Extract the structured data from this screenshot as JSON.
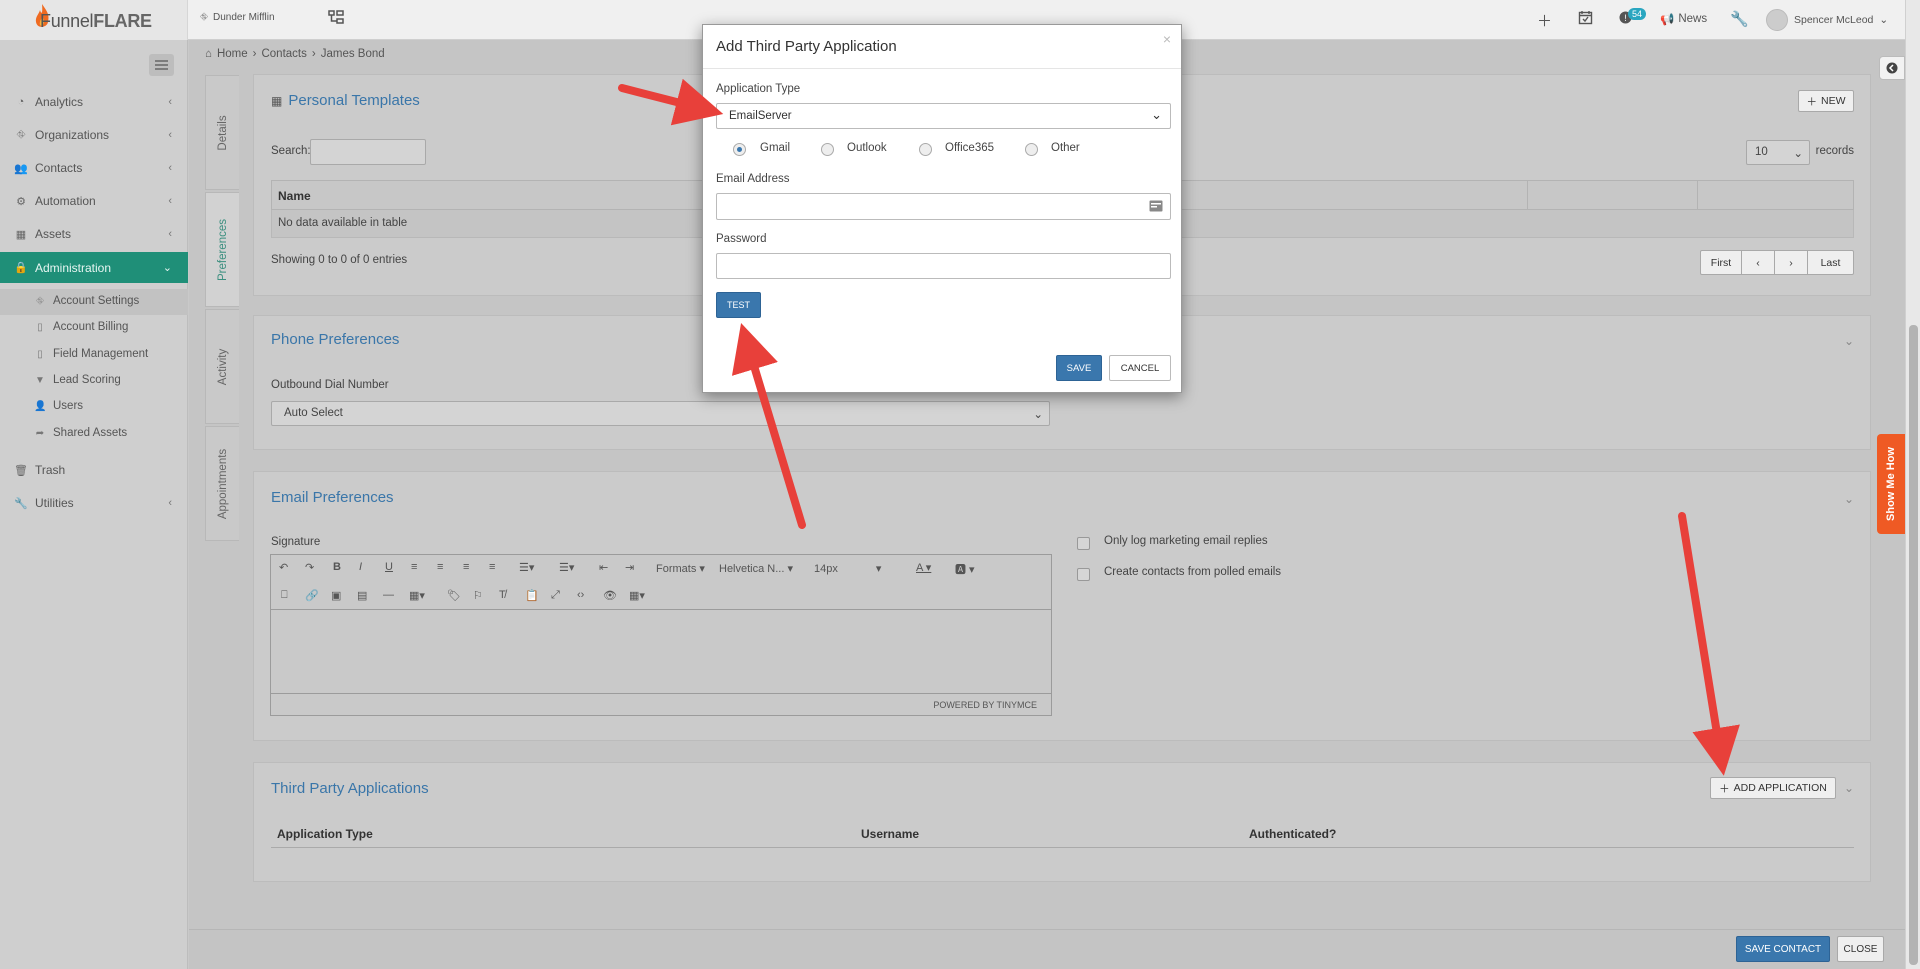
{
  "brand": {
    "name_a": "Funnel",
    "name_b": "FLARE"
  },
  "topbar": {
    "org": "Dunder Mifflin",
    "notif_count": "54",
    "news": "News",
    "user": "Spencer McLeod"
  },
  "breadcrumb": [
    "Home",
    "Contacts",
    "James Bond"
  ],
  "sidebar": {
    "items": [
      {
        "label": "Analytics",
        "icon": "dashboard-icon"
      },
      {
        "label": "Organizations",
        "icon": "sitemap-icon"
      },
      {
        "label": "Contacts",
        "icon": "users-icon"
      },
      {
        "label": "Automation",
        "icon": "cogs-icon"
      },
      {
        "label": "Assets",
        "icon": "grid-icon"
      },
      {
        "label": "Administration",
        "icon": "lock-icon",
        "active": true
      },
      {
        "label": "Trash",
        "icon": "trash-icon"
      },
      {
        "label": "Utilities",
        "icon": "wrench-icon"
      }
    ],
    "admin_sub": [
      "Account Settings",
      "Account Billing",
      "Field Management",
      "Lead Scoring",
      "Users",
      "Shared Assets"
    ]
  },
  "vtabs": [
    "Details",
    "Preferences",
    "Activity",
    "Appointments"
  ],
  "templates": {
    "title": "Personal Templates",
    "new_btn": "NEW",
    "search_label": "Search:",
    "records_value": "10",
    "records_label": "records",
    "col_name": "Name",
    "empty": "No data available in table",
    "showing": "Showing 0 to 0 of 0 entries",
    "pager": [
      "First",
      "‹",
      "›",
      "Last"
    ]
  },
  "phone": {
    "title": "Phone Preferences",
    "label": "Outbound Dial Number",
    "value": "Auto Select"
  },
  "email_prefs": {
    "title": "Email Preferences",
    "signature": "Signature",
    "formats": "Formats",
    "font": "Helvetica N...",
    "size": "14px",
    "powered": "POWERED BY TINYMCE",
    "opt1": "Only log marketing email replies",
    "opt2": "Create contacts from polled emails"
  },
  "third_party": {
    "title": "Third Party Applications",
    "add_btn": "ADD APPLICATION",
    "cols": [
      "Application Type",
      "Username",
      "Authenticated?"
    ]
  },
  "footer": {
    "save": "SAVE CONTACT",
    "close": "CLOSE"
  },
  "showme": "Show Me How",
  "modal": {
    "title": "Add Third Party Application",
    "app_type_label": "Application Type",
    "app_type_value": "EmailServer",
    "radios": [
      {
        "label": "Gmail",
        "checked": true
      },
      {
        "label": "Outlook",
        "checked": false
      },
      {
        "label": "Office365",
        "checked": false
      },
      {
        "label": "Other",
        "checked": false
      }
    ],
    "email_label": "Email Address",
    "email_value": "",
    "password_label": "Password",
    "password_value": "",
    "test_btn": "TEST",
    "save_btn": "SAVE",
    "cancel_btn": "CANCEL"
  },
  "colors": {
    "accent": "#1f8f78",
    "primary": "#3a77ad",
    "arrow": "#e8403a",
    "showme": "#ef5a24"
  }
}
